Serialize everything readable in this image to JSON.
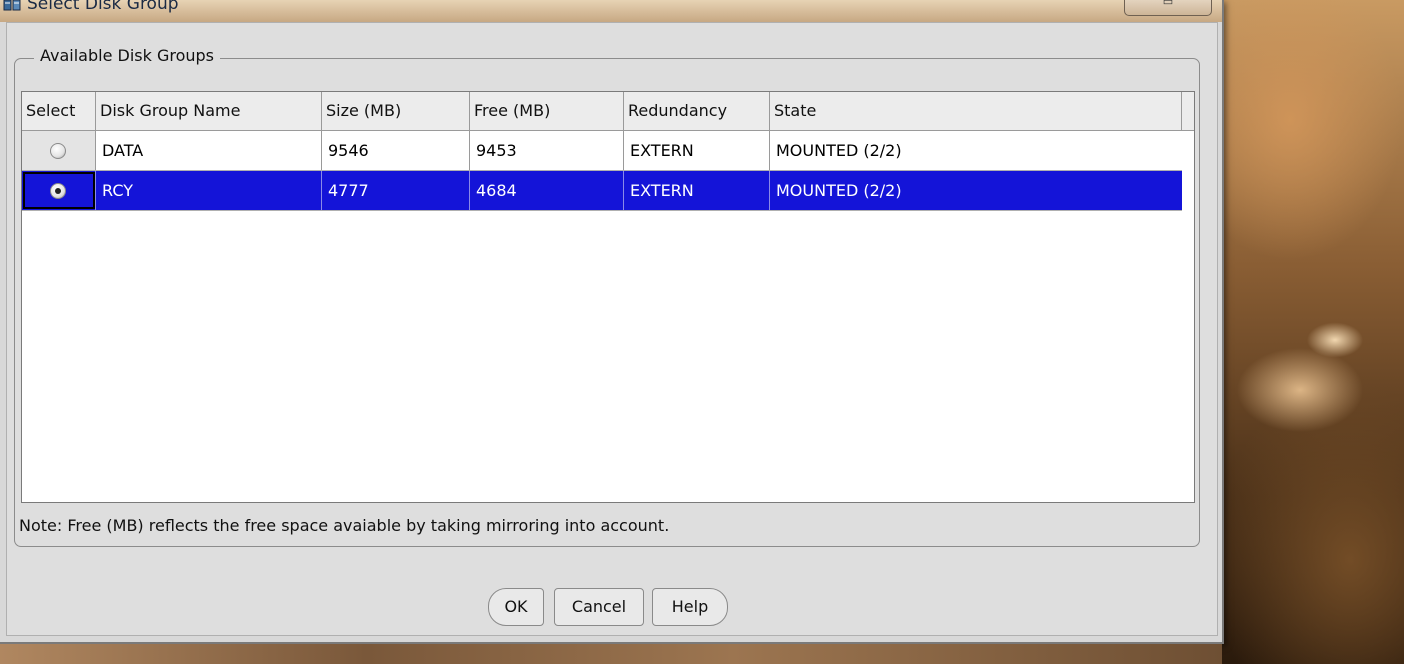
{
  "window": {
    "title": "Select Disk Group",
    "title_icon": "disk-group-icon"
  },
  "group": {
    "legend": "Available Disk Groups"
  },
  "table": {
    "headers": [
      "Select",
      "Disk Group Name",
      "Size (MB)",
      "Free (MB)",
      "Redundancy",
      "State"
    ],
    "rows": [
      {
        "selected": false,
        "name": "DATA",
        "size": "9546",
        "free": "9453",
        "redundancy": "EXTERN",
        "state": "MOUNTED (2/2)"
      },
      {
        "selected": true,
        "name": "RCY",
        "size": "4777",
        "free": "4684",
        "redundancy": "EXTERN",
        "state": "MOUNTED (2/2)"
      }
    ]
  },
  "note": "Note: Free (MB) reflects the free space avaiable by taking mirroring into account.",
  "buttons": {
    "ok": "OK",
    "cancel": "Cancel",
    "help": "Help"
  },
  "colors": {
    "selection": "#1414d8",
    "dialog_bg": "#dedede"
  }
}
